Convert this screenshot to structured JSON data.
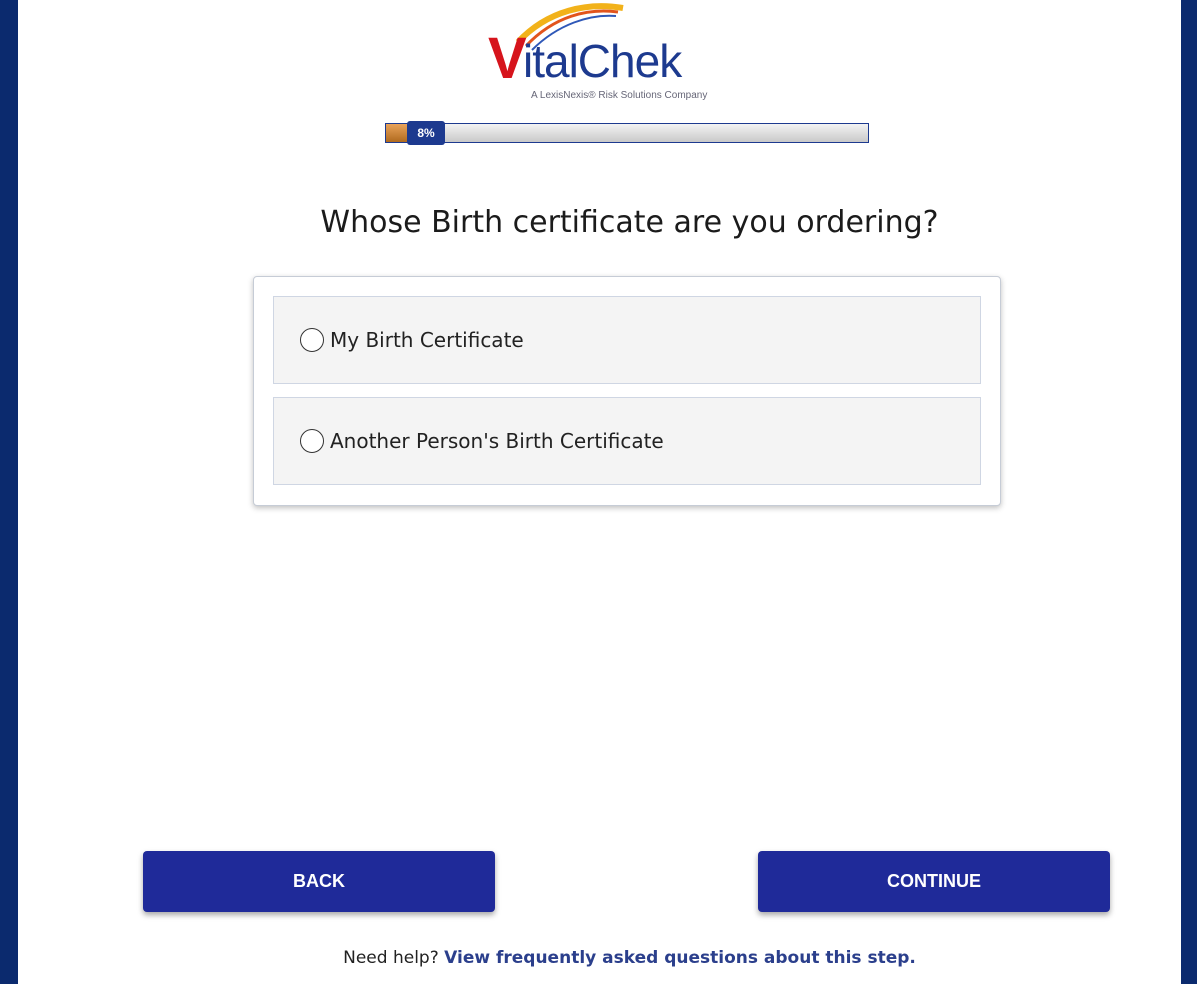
{
  "logo": {
    "v": "V",
    "name": "italChek",
    "tagline": "A LexisNexis® Risk Solutions Company",
    "icon": "vitalchek-logo"
  },
  "progress": {
    "percent_label": "8%",
    "value": 0.08
  },
  "question": "Whose Birth certificate are you ordering?",
  "options": [
    {
      "label": "My Birth Certificate",
      "selected": false
    },
    {
      "label": "Another Person's Birth Certificate",
      "selected": false
    }
  ],
  "buttons": {
    "back": "BACK",
    "continue": "CONTINUE"
  },
  "help": {
    "prefix": "Need help? ",
    "link": "View frequently asked questions about this step."
  },
  "colors": {
    "primary": "#1f2a99",
    "background": "#0b2a6e",
    "brand_red": "#d6141c",
    "brand_blue": "#1d3a8f",
    "progress_fill": "#c47a2a"
  }
}
